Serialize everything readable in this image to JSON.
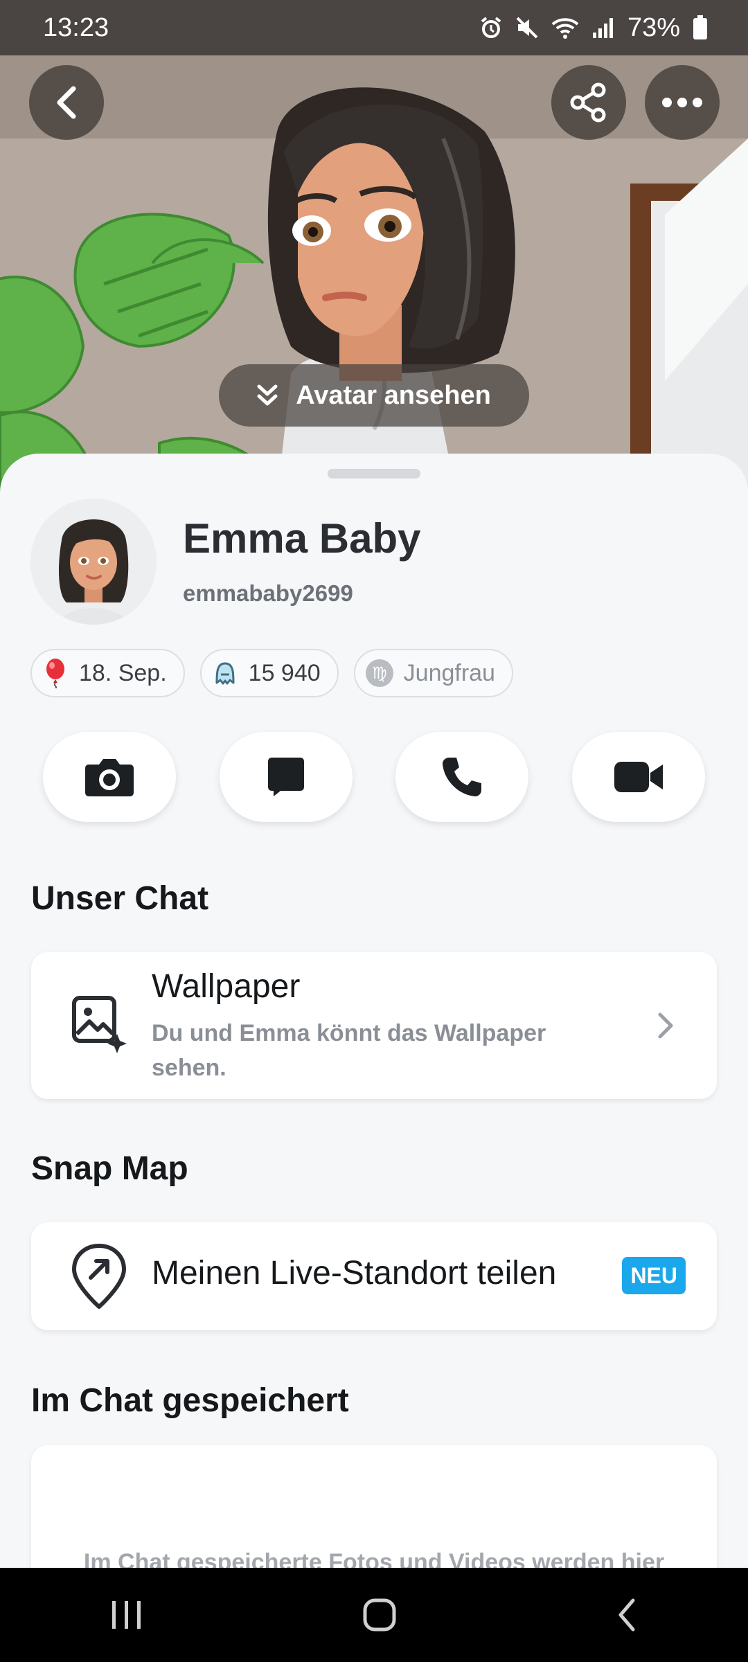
{
  "status_bar": {
    "time": "13:23",
    "battery": "73%"
  },
  "hero": {
    "avatar_button_label": "Avatar ansehen"
  },
  "profile": {
    "display_name": "Emma Baby",
    "username": "emmababy2699"
  },
  "chips": [
    {
      "icon": "balloon-icon",
      "label": "18. Sep."
    },
    {
      "icon": "ghost-icon",
      "label": "15 940"
    },
    {
      "icon": "virgo-icon",
      "label": "Jungfrau"
    }
  ],
  "actions": [
    "camera-icon",
    "chat-icon",
    "phone-icon",
    "video-icon"
  ],
  "our_chat": {
    "title": "Unser Chat",
    "wallpaper": {
      "title": "Wallpaper",
      "description": "Du und Emma könnt das Wallpaper sehen."
    }
  },
  "snap_map": {
    "title": "Snap Map",
    "live_location": {
      "label": "Meinen Live-Standort teilen",
      "badge": "NEU"
    }
  },
  "saved_in_chat": {
    "title": "Im Chat gespeichert",
    "empty_text": "Im Chat gespeicherte Fotos und Videos werden hier"
  },
  "colors": {
    "accent_badge": "#1aa7ec",
    "background": "#f6f7f9"
  }
}
